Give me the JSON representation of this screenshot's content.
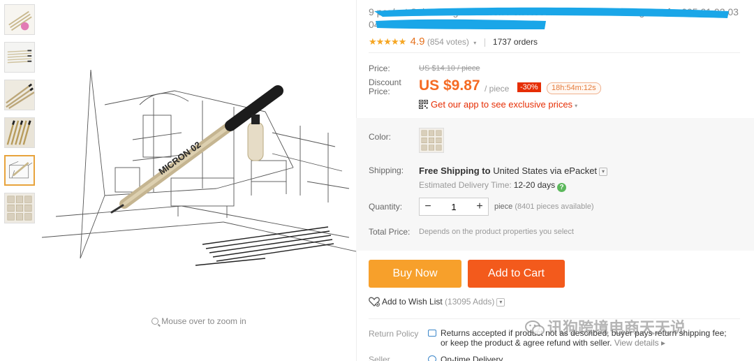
{
  "gallery": {
    "thumbnails": [
      {
        "name": "thumb-1"
      },
      {
        "name": "thumb-2"
      },
      {
        "name": "thumb-3"
      },
      {
        "name": "thumb-4"
      },
      {
        "name": "thumb-5"
      },
      {
        "name": "thumb-6"
      }
    ],
    "active_index": 4,
    "pen_label": "MICRON 02",
    "zoom_hint": "Mouse over to zoom in"
  },
  "product": {
    "title": "9 pcs/set Sakura Pigma Micron Pen Needle Soft Brush Drawing Pen for 005 01 02 03 04 05 08 1.0 Brush Art Markers",
    "stars": "★★★★★",
    "rating": "4.9",
    "votes": "(854 votes)",
    "orders": "1737 orders"
  },
  "pricing": {
    "price_label": "Price:",
    "old_price": "US $14.10 / piece",
    "discount_label_1": "Discount",
    "discount_label_2": "Price:",
    "price": "US $9.87",
    "per_piece": "/ piece",
    "discount": "-30%",
    "timer": "18h:54m:12s",
    "app_promo": "Get our app to see exclusive prices"
  },
  "options": {
    "color_label": "Color:",
    "shipping_label": "Shipping:",
    "shipping_free": "Free Shipping to",
    "shipping_dest": "United States via ePacket",
    "est_label": "Estimated Delivery Time:",
    "est_days": "12-20 days",
    "quantity_label": "Quantity:",
    "quantity": "1",
    "qty_unit": "piece",
    "qty_available": "(8401 pieces available)",
    "total_label": "Total Price:",
    "total_note": "Depends on the product properties you select"
  },
  "actions": {
    "buy_now": "Buy Now",
    "add_to_cart": "Add to Cart",
    "wish_label": "Add to Wish List",
    "wish_count": "(13095 Adds)"
  },
  "policy": {
    "return_label": "Return Policy",
    "return_text_1": "Returns accepted if product not as described, buyer pays return shipping fee;",
    "return_text_2": "or keep the product & agree refund with seller.",
    "view_details": "View details ▸",
    "seller_label": "Seller",
    "ontime": "On-time Delivery"
  },
  "watermark": "讯狗跨境电商天天说",
  "colors": {
    "price_orange": "#f56a23",
    "buy_now": "#f7a02b",
    "add_to_cart": "#f35a1c",
    "redaction_blue": "#1aa6e8",
    "discount_red": "#e62e04"
  }
}
